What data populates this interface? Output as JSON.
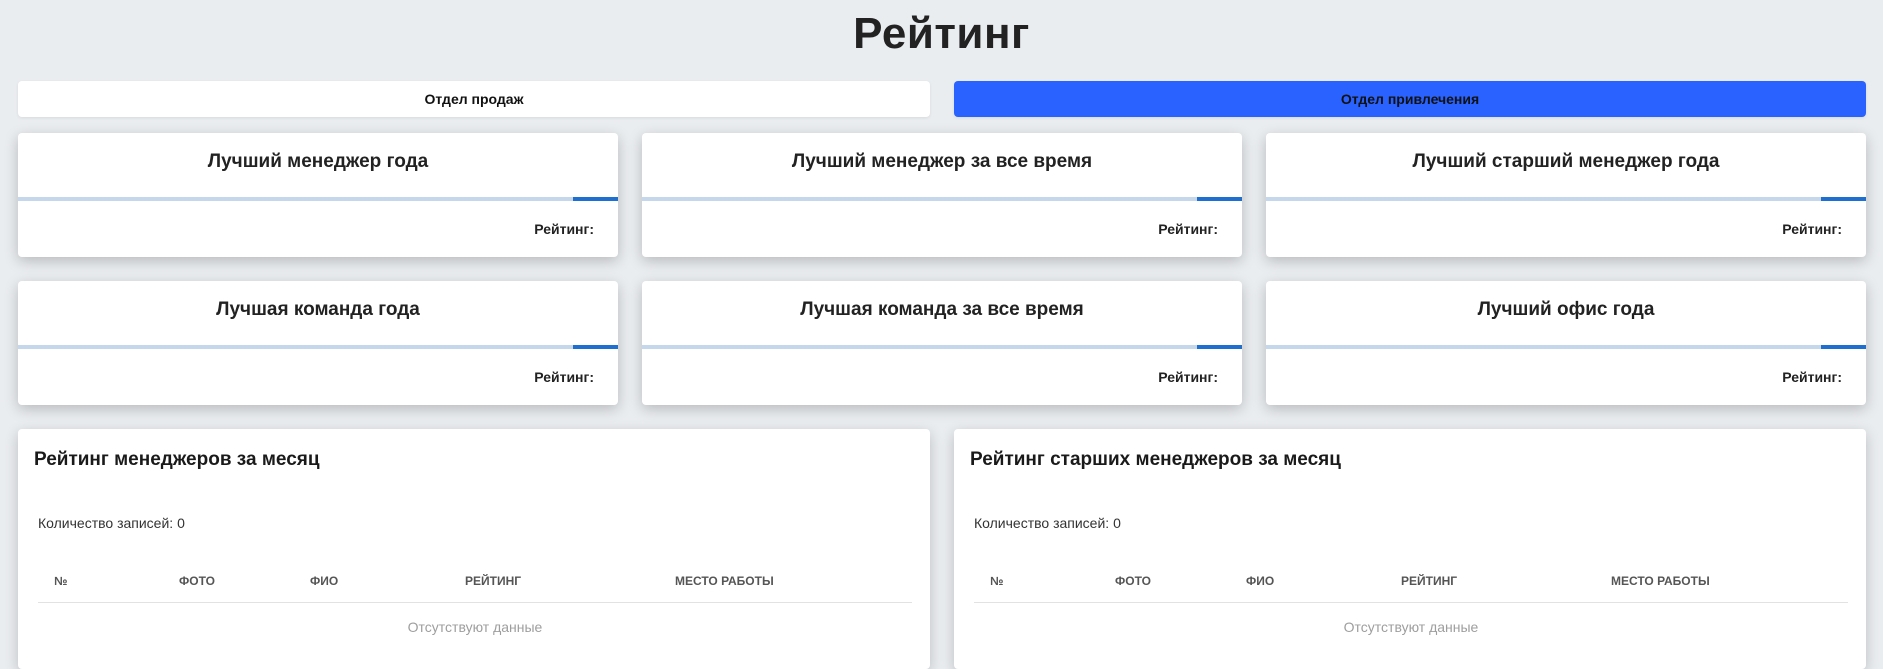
{
  "page": {
    "title": "Рейтинг"
  },
  "departments": {
    "tabs": [
      {
        "label": "Отдел продаж",
        "active": false
      },
      {
        "label": "Отдел привлечения",
        "active": true
      }
    ],
    "active_color": "#2962ff"
  },
  "awards": [
    {
      "title": "Лучший менеджер года",
      "rating_label": "Рейтинг:",
      "progress": 0.075
    },
    {
      "title": "Лучший менеджер за все время",
      "rating_label": "Рейтинг:",
      "progress": 0.075
    },
    {
      "title": "Лучший старший менеджер года",
      "rating_label": "Рейтинг:",
      "progress": 0.075
    },
    {
      "title": "Лучшая команда года",
      "rating_label": "Рейтинг:",
      "progress": 0.075
    },
    {
      "title": "Лучшая команда за все время",
      "rating_label": "Рейтинг:",
      "progress": 0.075
    },
    {
      "title": "Лучший офис года",
      "rating_label": "Рейтинг:",
      "progress": 0.075
    }
  ],
  "tables": [
    {
      "title": "Рейтинг менеджеров за месяц",
      "records_count": "Количество записей: 0",
      "columns": [
        "№",
        "ФОТО",
        "ФИО",
        "РЕЙТИНГ",
        "МЕСТО РАБОТЫ"
      ],
      "empty_text": "Отсутствуют данные"
    },
    {
      "title": "Рейтинг старших менеджеров за месяц",
      "records_count": "Количество записей: 0",
      "columns": [
        "№",
        "ФОТО",
        "ФИО",
        "РЕЙТИНГ",
        "МЕСТО РАБОТЫ"
      ],
      "empty_text": "Отсутствуют данные"
    }
  ],
  "colors": {
    "background": "#eaedf0",
    "bar_track": "#c5d7ea",
    "bar_fill": "#1f6fd1"
  }
}
